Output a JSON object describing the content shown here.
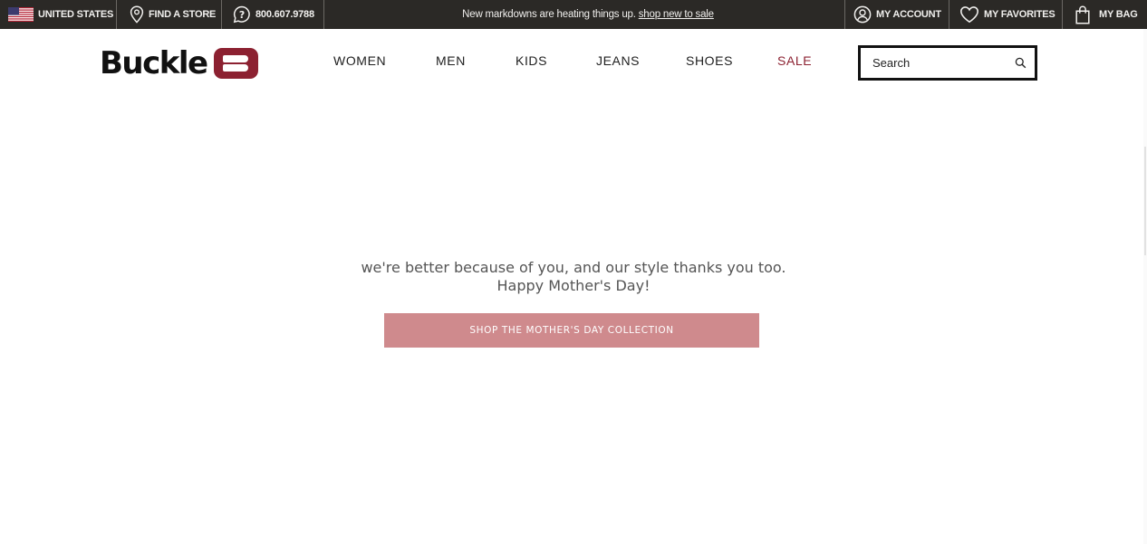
{
  "topbar": {
    "country": "UNITED STATES",
    "find_store": "FIND A STORE",
    "phone": "800.607.9788",
    "promo_text": "New markdowns are heating things up.",
    "promo_link": "shop new to sale",
    "account": "MY ACCOUNT",
    "favorites": "MY FAVORITES",
    "bag": "MY BAG",
    "background_color": "#2b2926"
  },
  "header": {
    "logo_text": "Buckle",
    "nav": {
      "women": "WOMEN",
      "men": "MEN",
      "kids": "KIDS",
      "jeans": "JEANS",
      "shoes": "SHOES",
      "sale": "SALE"
    },
    "sale_color": "#8c2131",
    "search": {
      "placeholder": "Search",
      "value": ""
    }
  },
  "main": {
    "line1": "we're better because of you, and our style thanks you too.",
    "line2": "Happy Mother's Day!",
    "cta_label": "SHOP THE MOTHER'S DAY COLLECTION",
    "cta_color": "#cf8a8d"
  },
  "icons": {
    "country": "us-flag-icon",
    "store": "location-pin-icon",
    "phone": "help-question-icon",
    "account": "user-circle-icon",
    "favorites": "heart-icon",
    "bag": "shopping-bag-icon",
    "search": "search-icon"
  }
}
